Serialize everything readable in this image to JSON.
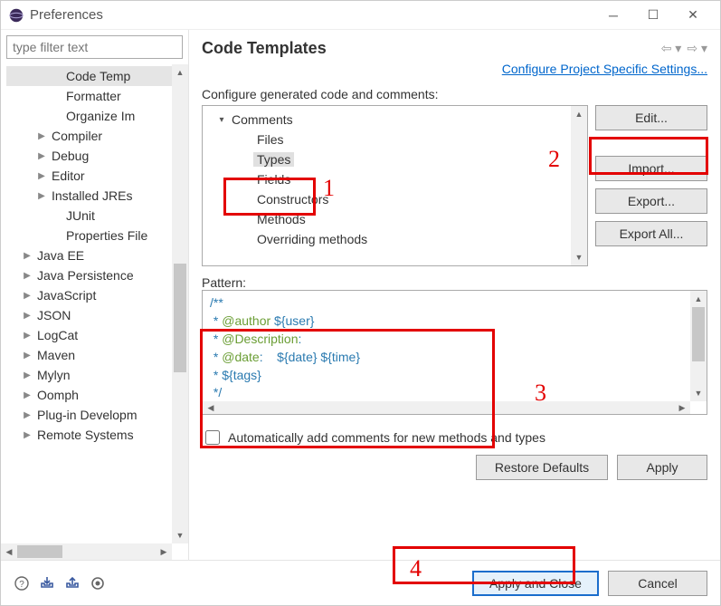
{
  "window": {
    "title": "Preferences"
  },
  "filter": {
    "placeholder": "type filter text"
  },
  "sidebar": {
    "items": [
      {
        "label": "Code Temp",
        "indent": 3,
        "arrow": "",
        "selected": true
      },
      {
        "label": "Formatter",
        "indent": 3,
        "arrow": ""
      },
      {
        "label": "Organize Im",
        "indent": 3,
        "arrow": ""
      },
      {
        "label": "Compiler",
        "indent": 2,
        "arrow": "▶"
      },
      {
        "label": "Debug",
        "indent": 2,
        "arrow": "▶"
      },
      {
        "label": "Editor",
        "indent": 2,
        "arrow": "▶"
      },
      {
        "label": "Installed JREs",
        "indent": 2,
        "arrow": "▶"
      },
      {
        "label": "JUnit",
        "indent": 3,
        "arrow": ""
      },
      {
        "label": "Properties File",
        "indent": 3,
        "arrow": ""
      },
      {
        "label": "Java EE",
        "indent": 1,
        "arrow": "▶"
      },
      {
        "label": "Java Persistence",
        "indent": 1,
        "arrow": "▶"
      },
      {
        "label": "JavaScript",
        "indent": 1,
        "arrow": "▶"
      },
      {
        "label": "JSON",
        "indent": 1,
        "arrow": "▶"
      },
      {
        "label": "LogCat",
        "indent": 1,
        "arrow": "▶"
      },
      {
        "label": "Maven",
        "indent": 1,
        "arrow": "▶"
      },
      {
        "label": "Mylyn",
        "indent": 1,
        "arrow": "▶"
      },
      {
        "label": "Oomph",
        "indent": 1,
        "arrow": "▶"
      },
      {
        "label": "Plug-in Developm",
        "indent": 1,
        "arrow": "▶"
      },
      {
        "label": "Remote Systems",
        "indent": 1,
        "arrow": "▶"
      }
    ]
  },
  "main": {
    "heading": "Code Templates",
    "config_link": "Configure Project Specific Settings...",
    "desc": "Configure generated code and comments:",
    "templates": [
      {
        "label": "Comments",
        "indent": 0,
        "arrow": "▾"
      },
      {
        "label": "Files",
        "indent": 1,
        "arrow": ""
      },
      {
        "label": "Types",
        "indent": 1,
        "arrow": "",
        "selected": true
      },
      {
        "label": "Fields",
        "indent": 1,
        "arrow": ""
      },
      {
        "label": "Constructors",
        "indent": 1,
        "arrow": ""
      },
      {
        "label": "Methods",
        "indent": 1,
        "arrow": ""
      },
      {
        "label": "Overriding methods",
        "indent": 1,
        "arrow": ""
      }
    ],
    "buttons": {
      "edit": "Edit...",
      "import": "Import...",
      "export": "Export...",
      "export_all": "Export All..."
    },
    "pattern_label": "Pattern:",
    "pattern": {
      "l1a": "/**",
      "l2a": " * ",
      "l2b": "@author",
      "l2c": " ${user}",
      "l3a": " * ",
      "l3b": "@Description",
      "l3c": ":",
      "l4a": " * ",
      "l4b": "@date",
      "l4c": ":    ${date} ${time}",
      "l5a": " * ${tags}",
      "l6a": " */"
    },
    "checkbox_label": "Automatically add comments for new methods and types",
    "restore": "Restore Defaults",
    "apply": "Apply"
  },
  "footer": {
    "apply_close": "Apply and Close",
    "cancel": "Cancel"
  },
  "annotations": {
    "n1": "1",
    "n2": "2",
    "n3": "3",
    "n4": "4"
  }
}
